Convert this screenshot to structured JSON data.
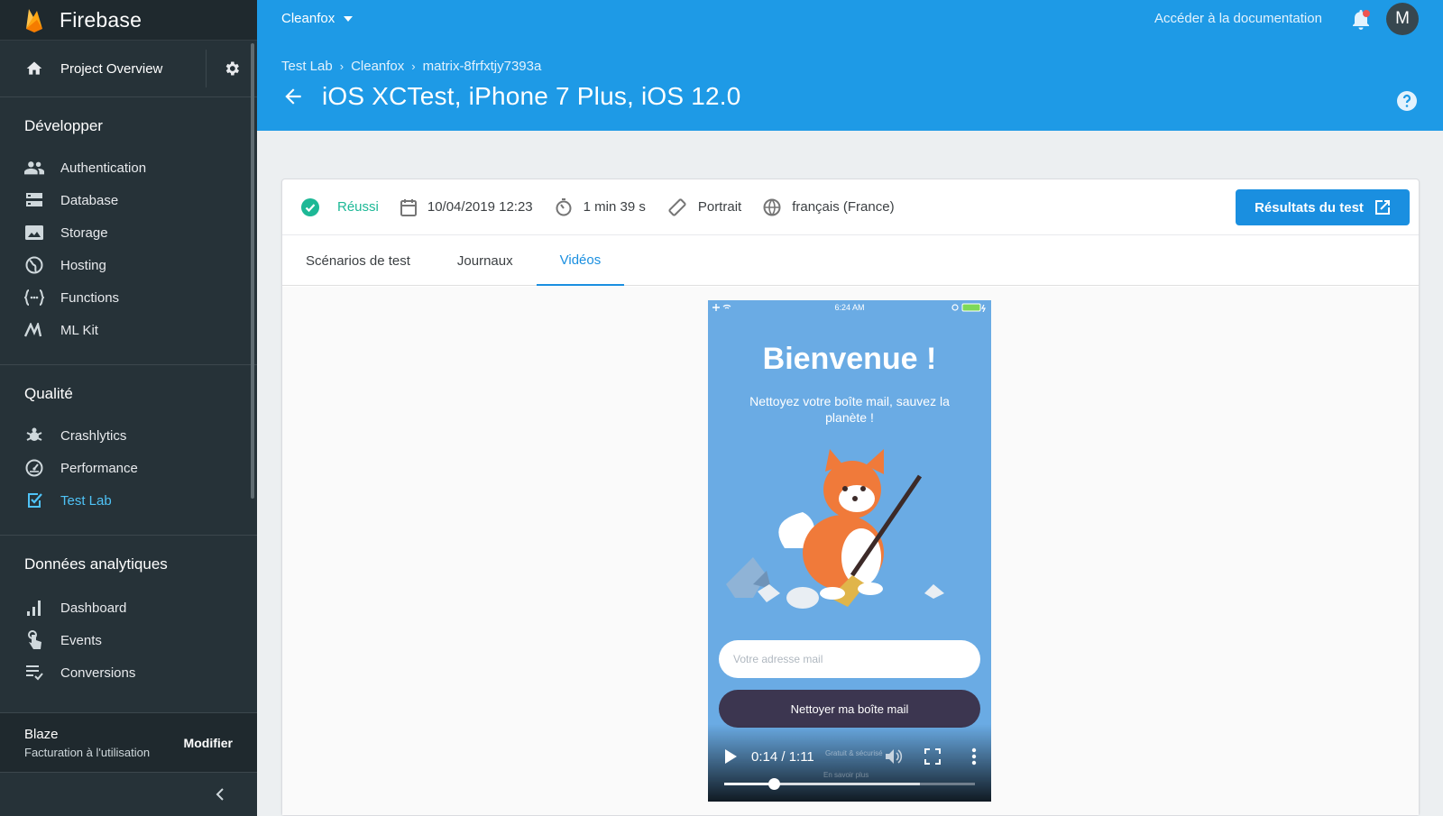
{
  "brand": {
    "name": "Firebase"
  },
  "sidebar": {
    "overview": "Project Overview",
    "sections": [
      {
        "title": "Développer",
        "items": [
          "Authentication",
          "Database",
          "Storage",
          "Hosting",
          "Functions",
          "ML Kit"
        ]
      },
      {
        "title": "Qualité",
        "items": [
          "Crashlytics",
          "Performance",
          "Test Lab"
        ]
      },
      {
        "title": "Données analytiques",
        "items": [
          "Dashboard",
          "Events",
          "Conversions"
        ]
      }
    ],
    "active_item": "Test Lab",
    "plan": {
      "name": "Blaze",
      "desc": "Facturation à l'utilisation",
      "action": "Modifier"
    }
  },
  "header": {
    "project": "Cleanfox",
    "docs_link": "Accéder à la documentation",
    "avatar_initial": "M",
    "breadcrumb": [
      "Test Lab",
      "Cleanfox",
      "matrix-8frfxtjy7393a"
    ],
    "title": "iOS XCTest, iPhone 7 Plus, iOS 12.0"
  },
  "status": {
    "result": "Réussi",
    "date": "10/04/2019 12:23",
    "duration": "1 min 39 s",
    "orientation": "Portrait",
    "locale": "français (France)",
    "results_button": "Résultats du test"
  },
  "tabs": [
    "Scénarios de test",
    "Journaux",
    "Vidéos"
  ],
  "active_tab": "Vidéos",
  "video": {
    "status_time": "6:24 AM",
    "welcome": "Bienvenue !",
    "subtitle": "Nettoyez votre boîte mail, sauvez la planète !",
    "email_placeholder": "Votre adresse mail",
    "cta": "Nettoyer ma boîte mail",
    "promo_line1": "Gratuit & sécurisé",
    "promo_line2": "En savoir plus",
    "time": "0:14 / 1:11",
    "played_fraction": 0.197,
    "buffered_fraction": 0.78
  },
  "colors": {
    "header": "#1e9ae6",
    "sidebar": "#263238",
    "accent": "#1a8fe0",
    "success": "#1db896"
  }
}
